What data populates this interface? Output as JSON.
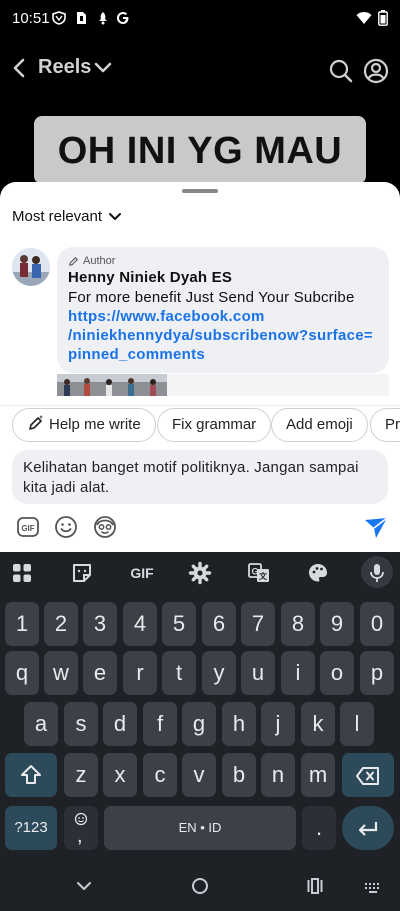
{
  "status_bar": {
    "time": "10:51"
  },
  "reels_bar": {
    "title": "Reels"
  },
  "video": {
    "overlay_text": "OH INI YG MAU"
  },
  "comments": {
    "sort_label": "Most relevant",
    "pinned": {
      "badge": "Author",
      "name": "Henny Niniek Dyah ES",
      "text": "For more benefit Just Send Your Subcribe",
      "link_lines": [
        "https://www.facebook.com",
        "/niniekhennydya/subscribenow?surface=",
        "pinned_comments"
      ]
    }
  },
  "suggestions": [
    "Help me write",
    "Fix grammar",
    "Add emoji",
    "Pro"
  ],
  "composer": {
    "text_line1": "Kelihatan banget motif politiknya. Jangan sampai",
    "text_line2": "kita jadi alat."
  },
  "keyboard": {
    "toolbar_gif": "GIF",
    "row_numbers": [
      "1",
      "2",
      "3",
      "4",
      "5",
      "6",
      "7",
      "8",
      "9",
      "0"
    ],
    "row1": [
      "q",
      "w",
      "e",
      "r",
      "t",
      "y",
      "u",
      "i",
      "o",
      "p"
    ],
    "row2": [
      "a",
      "s",
      "d",
      "f",
      "g",
      "h",
      "j",
      "k",
      "l"
    ],
    "row3": [
      "z",
      "x",
      "c",
      "v",
      "b",
      "n",
      "m"
    ],
    "symbols_key": "?123",
    "comma_key": ",",
    "space_label": "EN • ID",
    "period_key": "."
  },
  "colors": {
    "link": "#1a73e8",
    "send": "#1877f2",
    "keyboard_bg": "#1e2227"
  }
}
